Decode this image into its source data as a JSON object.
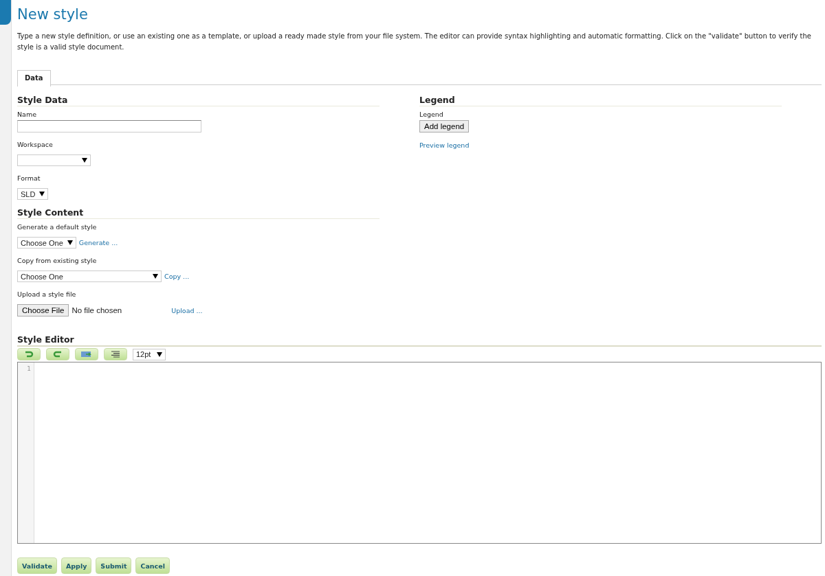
{
  "title": "New style",
  "description": "Type a new style definition, or use an existing one as a template, or upload a ready made style from your file system. The editor can provide syntax highlighting and automatic formatting. Click on the \"validate\" button to verify the style is a valid style document.",
  "tabs": [
    {
      "label": "Data",
      "selected": true
    }
  ],
  "style_data": {
    "heading": "Style Data",
    "name_label": "Name",
    "workspace_label": "Workspace",
    "format_label": "Format",
    "format_value": "SLD"
  },
  "style_content": {
    "heading": "Style Content",
    "generate_label": "Generate a default style",
    "generate_select": "Choose One",
    "generate_link": "Generate ...",
    "copy_label": "Copy from existing style",
    "copy_select": "Choose One",
    "copy_link": "Copy ...",
    "upload_label": "Upload a style file",
    "choose_file": "Choose File",
    "file_status": "No file chosen",
    "upload_link": "Upload ..."
  },
  "legend": {
    "heading": "Legend",
    "label": "Legend",
    "add_button": "Add legend",
    "preview_link": "Preview legend"
  },
  "editor": {
    "heading": "Style Editor",
    "font_size": "12pt",
    "line_numbers": [
      "1"
    ]
  },
  "buttons": [
    "Validate",
    "Apply",
    "Submit",
    "Cancel"
  ]
}
